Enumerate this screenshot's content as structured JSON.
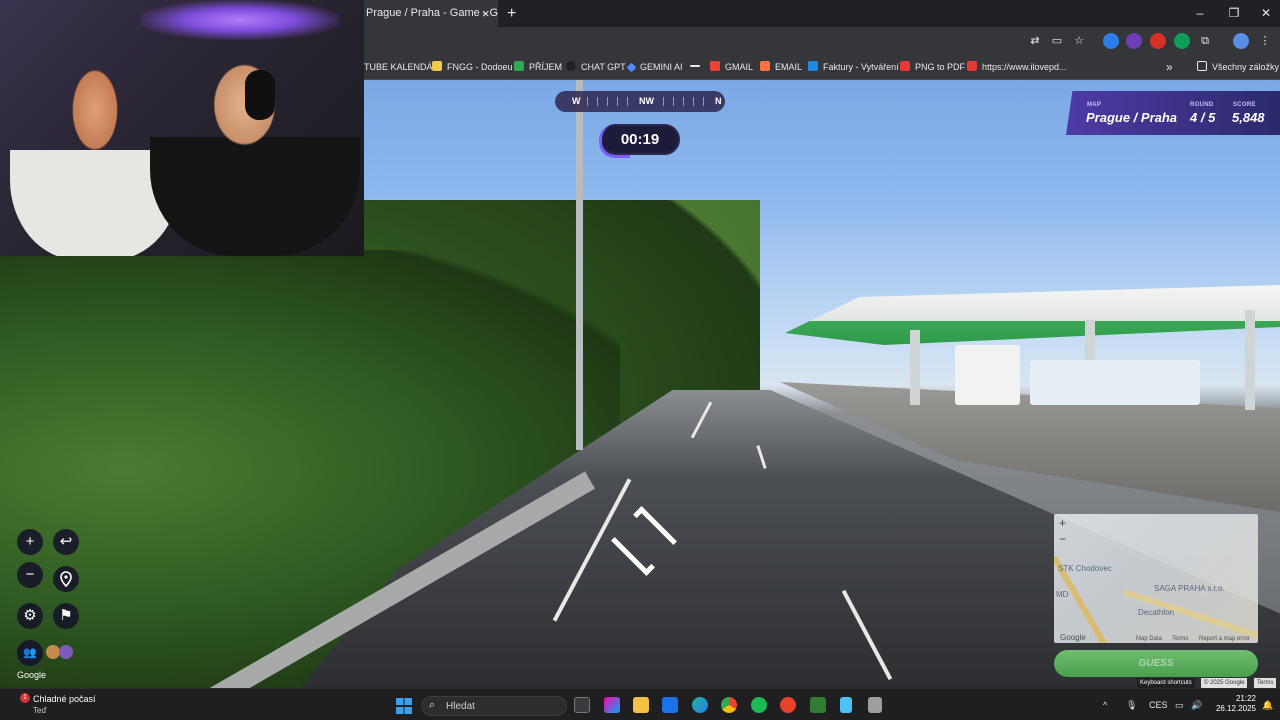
{
  "browser": {
    "tab_title": "Prague / Praha - Game - GeoG",
    "tab_close": "×",
    "new_tab": "+",
    "window_controls": {
      "minimize": "–",
      "maximize": "❐",
      "close": "✕"
    },
    "bookmarks": [
      {
        "label": "TUBE KALENDÁŘ",
        "color": "#e53935"
      },
      {
        "label": "FNGG - Dodoeu",
        "color": "#f2c94c"
      },
      {
        "label": "PŘÍJEM",
        "color": "#2fa84f"
      },
      {
        "label": "CHAT GPT",
        "color": "#202124"
      },
      {
        "label": "GEMINI AI",
        "color": "#4f8cff"
      },
      {
        "label": "",
        "color": "#111111"
      },
      {
        "label": "GMAIL",
        "color": "#ea4335"
      },
      {
        "label": "EMAIL",
        "color": "#ff7043"
      },
      {
        "label": "Faktury - Vytváření",
        "color": "#1e88e5"
      },
      {
        "label": "PNG to PDF",
        "color": "#e53935"
      },
      {
        "label": "https://www.ilovepd...",
        "color": "#e53935"
      }
    ],
    "bookmarks_overflow": "»",
    "all_bookmarks": "Všechny záložky"
  },
  "game": {
    "compass": {
      "left": "W",
      "center": "NW",
      "right": "N"
    },
    "timer": "00:19",
    "scoreboard": {
      "map_label": "MAP",
      "map_value": "Prague / Praha",
      "round_label": "ROUND",
      "round_value": "4 / 5",
      "score_label": "SCORE",
      "score_value": "5,848"
    },
    "controls": {
      "zoom_in": "+",
      "zoom_out": "−",
      "undo": "↩",
      "settings": "⚙",
      "flag": "⚑"
    },
    "google_watermark": "Google",
    "minimap": {
      "zoom_in": "+",
      "zoom_out": "−",
      "labels": [
        "STK Chodovec",
        "SAGA PRAHA s.r.o.",
        "Decathlon",
        "MD"
      ],
      "footer_brand": "Google",
      "footer_links": [
        "Map Data",
        "Terms",
        "Report a map error"
      ]
    },
    "guess_button": "GUESS",
    "attribution": [
      "Keyboard shortcuts",
      "© 2025 Google",
      "Terms"
    ]
  },
  "taskbar": {
    "weather_badge": "1",
    "weather_title": "Chladné počasí",
    "weather_sub": "Teď",
    "search_placeholder": "Hledat",
    "language": "CES",
    "time": "21:22",
    "date": "26.12.2025",
    "tray_chevron": "^"
  }
}
